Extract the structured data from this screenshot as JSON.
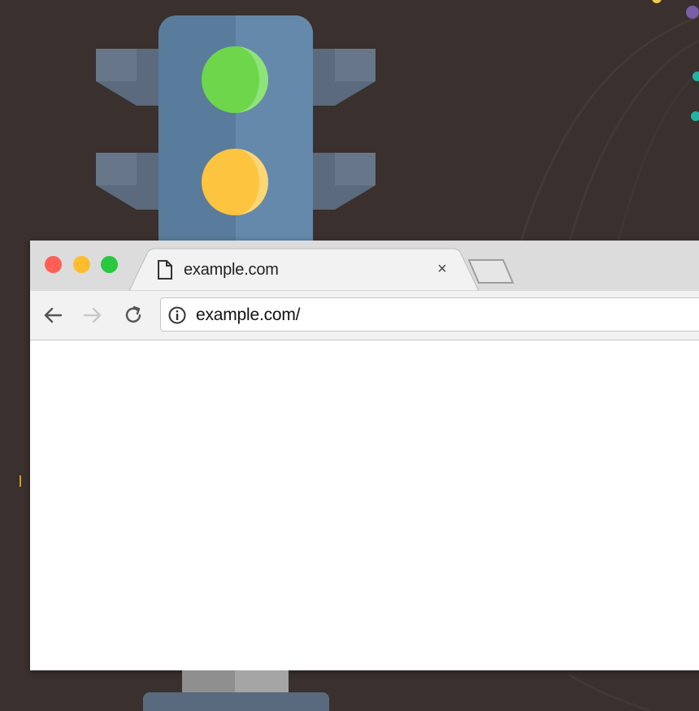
{
  "tab": {
    "title": "example.com",
    "close_glyph": "×"
  },
  "address_bar": {
    "url": "example.com/"
  },
  "icons": {
    "tab_page": "document-icon",
    "close": "close-icon",
    "new_tab": "new-tab-icon",
    "back": "back-arrow-icon",
    "forward": "forward-arrow-icon",
    "reload": "reload-icon",
    "site_info": "info-icon"
  },
  "colors": {
    "background": "#3a302d",
    "window_close": "#ff5f57",
    "window_minimize": "#ffbd2e",
    "window_maximize": "#28c940",
    "traffic_light_body": "#5f7f9f",
    "light_green": "#6ed64a",
    "light_yellow": "#fdc43f"
  }
}
